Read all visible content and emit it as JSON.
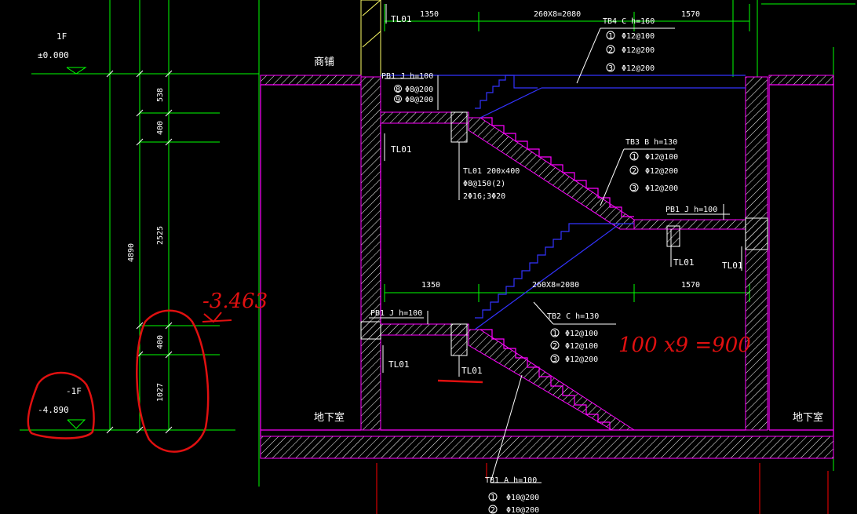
{
  "labels": {
    "floor_1f": "1F",
    "elev_1f": "±0.000",
    "floor_b1": "-1F",
    "elev_b1": "-4.890",
    "shop": "商铺",
    "basement_left": "地下室",
    "basement_right": "地下室",
    "tl01_top": "TL01",
    "tl01_mid": "TL01",
    "tl01_right_mid": "TL01",
    "tl01_right_far": "TL01",
    "tl01_lower": "TL01",
    "tl01_lower_beam": "TL01"
  },
  "dims_vertical": {
    "d538": "538",
    "d400a": "400",
    "d2525": "2525",
    "d400b": "400",
    "d1027": "1027",
    "d4890": "4890"
  },
  "dims_top": {
    "a": "1350",
    "b": "260X8=2080",
    "c": "1570"
  },
  "dims_mid": {
    "a": "1350",
    "b": "260X8=2080",
    "c": "1570"
  },
  "tb4": {
    "title": "TB4 C h=160",
    "r1": "Φ12@100",
    "r2": "Φ12@200",
    "r3": "Φ12@200",
    "n1": "1",
    "n2": "2",
    "n3": "3"
  },
  "tb3": {
    "title": "TB3 B h=130",
    "r1": "Φ12@100",
    "r2": "Φ12@200",
    "r3": "Φ12@200",
    "n1": "1",
    "n2": "2",
    "n3": "3"
  },
  "tb2": {
    "title": "TB2 C h=130",
    "r1": "Φ12@100",
    "r2": "Φ12@100",
    "r3": "Φ12@200",
    "n1": "1",
    "n2": "2",
    "n3": "3"
  },
  "tb1": {
    "title": "TB1 A h=100",
    "r1": "Φ10@200",
    "r2": "Φ10@200",
    "n1": "1",
    "n2": "2"
  },
  "pb1_top": {
    "title": "PB1 J h=100",
    "r1": "Φ8@200",
    "r2": "Φ8@200",
    "n1": "8",
    "n2": "9"
  },
  "pb1_mid": {
    "title": "PB1 J h=100"
  },
  "pb1_low": {
    "title": "PB1 J h=100"
  },
  "tl01_detail": {
    "l1": "TL01 200x400",
    "l2": "Φ8@150(2)",
    "l3": "2Φ16;3Φ20"
  },
  "annotations": {
    "elev_handwritten": "-3.463",
    "formula_handwritten": "100 x9 =900"
  },
  "colors": {
    "green": "#00ff00",
    "magenta": "#ff00ff",
    "blue": "#0000ff",
    "red": "#ff0000",
    "yellow": "#ffff66",
    "white": "#ffffff",
    "hand_red": "#e01010"
  }
}
